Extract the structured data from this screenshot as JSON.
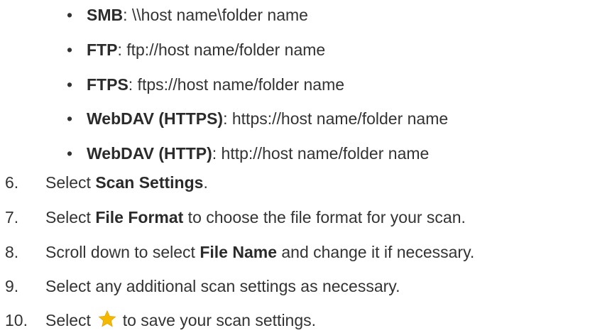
{
  "bullets": [
    {
      "bullet": "•",
      "term": "SMB",
      "rest": ": \\\\host name\\folder name"
    },
    {
      "bullet": "•",
      "term": "FTP",
      "rest": ": ftp://host name/folder name"
    },
    {
      "bullet": "•",
      "term": "FTPS",
      "rest": ": ftps://host name/folder name"
    },
    {
      "bullet": "•",
      "term": "WebDAV (HTTPS)",
      "rest": ": https://host name/folder name"
    },
    {
      "bullet": "•",
      "term": "WebDAV (HTTP)",
      "rest": ": http://host name/folder name"
    }
  ],
  "steps": [
    {
      "num": "6.",
      "pre": "Select ",
      "bold": "Scan Settings",
      "post": "."
    },
    {
      "num": "7.",
      "pre": "Select ",
      "bold": "File Format",
      "post": " to choose the file format for your scan."
    },
    {
      "num": "8.",
      "pre": "Scroll down to select ",
      "bold": "File Name",
      "post": " and change it if necessary."
    },
    {
      "num": "9.",
      "text": "Select any additional scan settings as necessary."
    },
    {
      "num": "10.",
      "pre": "Select ",
      "icon": "star-icon",
      "post": " to save your scan settings."
    }
  ],
  "colors": {
    "text": "#333333",
    "star": "#f5b800"
  }
}
